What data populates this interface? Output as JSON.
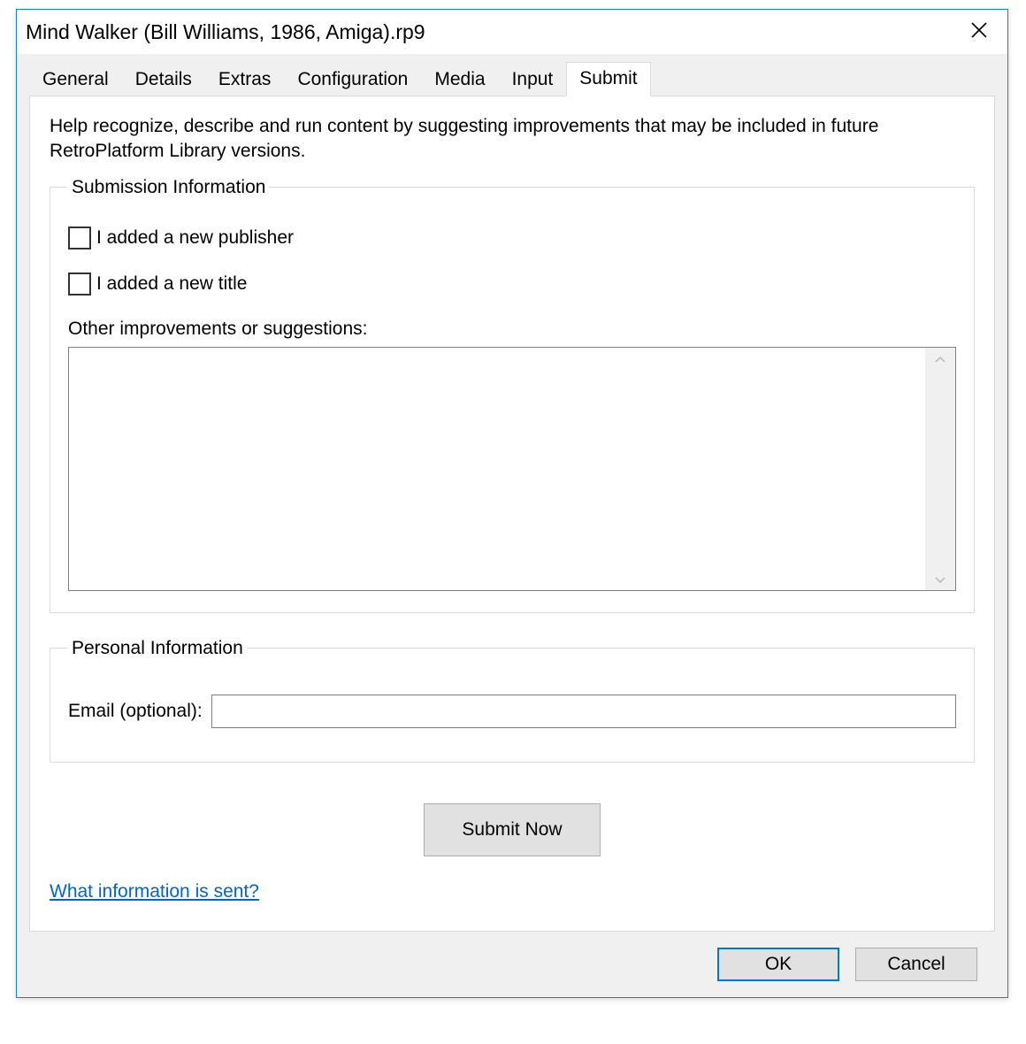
{
  "window": {
    "title": "Mind Walker (Bill Williams, 1986, Amiga).rp9"
  },
  "tabs": {
    "items": [
      {
        "label": "General",
        "active": false
      },
      {
        "label": "Details",
        "active": false
      },
      {
        "label": "Extras",
        "active": false
      },
      {
        "label": "Configuration",
        "active": false
      },
      {
        "label": "Media",
        "active": false
      },
      {
        "label": "Input",
        "active": false
      },
      {
        "label": "Submit",
        "active": true
      }
    ]
  },
  "submit_panel": {
    "help_text": "Help recognize, describe and run content by suggesting improvements that may be included in future RetroPlatform Library versions.",
    "submission_group": {
      "legend": "Submission Information",
      "checkbox_publisher": {
        "label": "I added a new publisher",
        "checked": false
      },
      "checkbox_title": {
        "label": "I added a new title",
        "checked": false
      },
      "other_label": "Other improvements or suggestions:",
      "other_value": ""
    },
    "personal_group": {
      "legend": "Personal Information",
      "email_label": "Email (optional):",
      "email_value": ""
    },
    "submit_button": "Submit Now",
    "info_link": "What information is sent?"
  },
  "buttons": {
    "ok": "OK",
    "cancel": "Cancel"
  }
}
